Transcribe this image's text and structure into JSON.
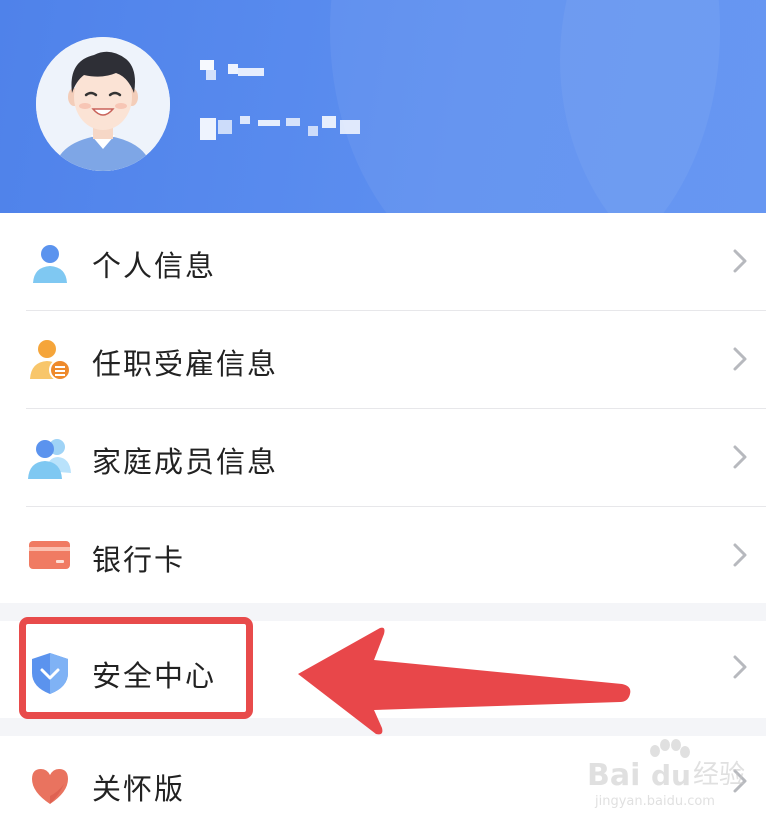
{
  "profile": {
    "avatar_icon": "user-avatar-icon",
    "name_redacted": true,
    "phone_redacted": true
  },
  "menu": {
    "items": [
      {
        "label": "个人信息",
        "icon": "person-icon"
      },
      {
        "label": "任职受雇信息",
        "icon": "employment-icon"
      },
      {
        "label": "家庭成员信息",
        "icon": "family-icon"
      },
      {
        "label": "银行卡",
        "icon": "bank-card-icon"
      }
    ],
    "security": {
      "label": "安全中心",
      "icon": "shield-icon"
    },
    "care": {
      "label": "关怀版",
      "icon": "heart-icon"
    }
  },
  "watermark": {
    "brand": "Bai",
    "brand_suffix": "du",
    "cn": "经验",
    "url": "jingyan.baidu.com"
  },
  "colors": {
    "header": "#5b8df0",
    "highlight": "#e84b4b",
    "arrow": "#e8474a"
  }
}
